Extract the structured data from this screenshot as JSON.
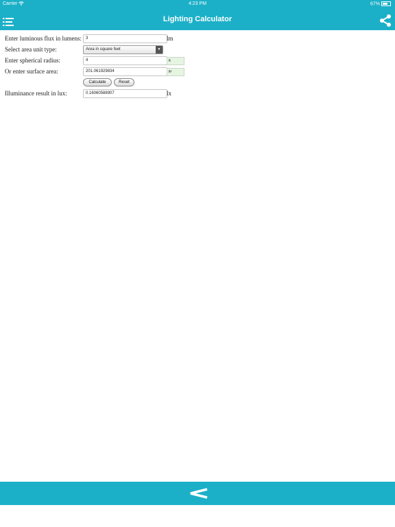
{
  "status": {
    "carrier": "Carrier",
    "time": "4:23 PM",
    "battery": "67%"
  },
  "header": {
    "title": "Lighting Calculator"
  },
  "form": {
    "flux": {
      "label": "Enter luminous flux in lumens:",
      "value": "3",
      "unit": "lm"
    },
    "area_unit": {
      "label": "Select area unit type:",
      "selected": "Area in square feet"
    },
    "radius": {
      "label": "Enter spherical radius:",
      "value": "4",
      "unit": "ft"
    },
    "surface": {
      "label": "Or enter surface area:",
      "value": "201.061929834",
      "unit": "ft²"
    },
    "buttons": {
      "calculate": "Calculate",
      "reset": "Reset"
    },
    "result": {
      "label": "Illuminance result in lux:",
      "value": "0.16060588907",
      "unit": "lx"
    }
  },
  "colors": {
    "accent": "#1cb0c8",
    "unit_box_bg": "#e6f5e2"
  },
  "icons": {
    "menu": "list-menu-icon",
    "share": "share-icon",
    "back": "back-chevron-icon",
    "wifi": "wifi-icon",
    "battery": "battery-icon"
  }
}
